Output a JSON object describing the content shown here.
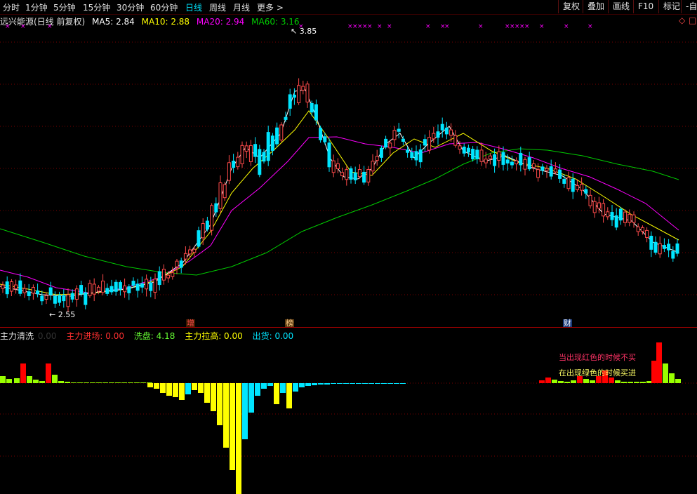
{
  "toolbar": {
    "periods": [
      "分时",
      "1分钟",
      "5分钟",
      "15分钟",
      "30分钟",
      "60分钟",
      "日线",
      "周线",
      "月线",
      "更多"
    ],
    "more_arrow": ">",
    "right_buttons": [
      "复权",
      "叠加",
      "画线",
      "F10",
      "标记",
      "-自"
    ]
  },
  "main": {
    "title": "远兴能源(日线 前复权)",
    "ma5": "MA5: 2.84",
    "ma10": "MA10: 2.88",
    "ma20": "MA20: 2.94",
    "ma60": "MA60: 3.16",
    "high_label": "3.85",
    "low_label": "2.55",
    "x_mark": "×",
    "diamond": "◇",
    "square": "□",
    "events": [
      "增",
      "榜",
      "财"
    ]
  },
  "indicator": {
    "name": "主力清洗",
    "values_dim": "0.00",
    "entry": "主力进场: 0.00",
    "wash": "洗盘: 4.18",
    "pull": "主力拉高: 0.00",
    "ship": "出货: 0.00",
    "note_red": "当出现红色的时候不买",
    "note_green": "在出现绿色的时候买进"
  },
  "colors": {
    "up": "#ff4a4a",
    "down": "#00e5ff",
    "ma5": "#ffffff",
    "ma10": "#ffff00",
    "ma20": "#ff00ff",
    "ma60": "#00cc00",
    "grid": "#7a0000",
    "ind_red": "#ff0000",
    "ind_green": "#99ff00",
    "ind_yellow": "#ffff00",
    "ind_cyan": "#00e5ff"
  }
}
